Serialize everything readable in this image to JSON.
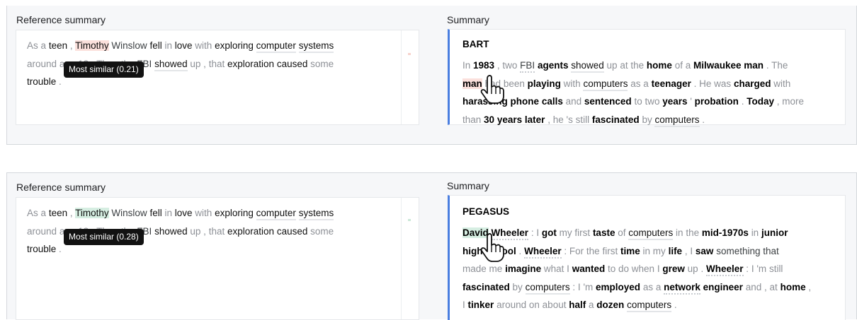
{
  "panels": [
    {
      "ref_title": "Reference summary",
      "sum_title": "Summary",
      "model": "BART",
      "tooltip": "Most similar (0.21)"
    },
    {
      "ref_title": "Reference summary",
      "sum_title": "Summary",
      "model": "PEGASUS",
      "tooltip": "Most similar (0.28)"
    }
  ],
  "reference_text": "As a teen , Timothy Winslow fell in love with exploring computer systems around age 13 . Then the FBI showed up , that exploration caused some trouble .",
  "bart_text": "In 1983 , two FBI agents showed up at the home of a Milwaukee man . The man had been playing with computers as a teenager . He was charged with harassing phone calls and sentenced to two years ' probation . Today , more than 30 years later , he 's still fascinated by computers .",
  "pegasus_text": "David Wheeler : I got my first taste of computers in the mid-1970s in junior high school . Wheeler : For the first time in my life , I saw something that made me imagine what I wanted to do when I grew up . Wheeler : I 'm still fascinated by computers : I 'm employed as a network engineer and , at home , I tinker around on about half a dozen computers .",
  "colors": {
    "accent": "#4a7ee0",
    "highlight_red": "#fbe0dc",
    "highlight_green": "#d6eee2"
  }
}
